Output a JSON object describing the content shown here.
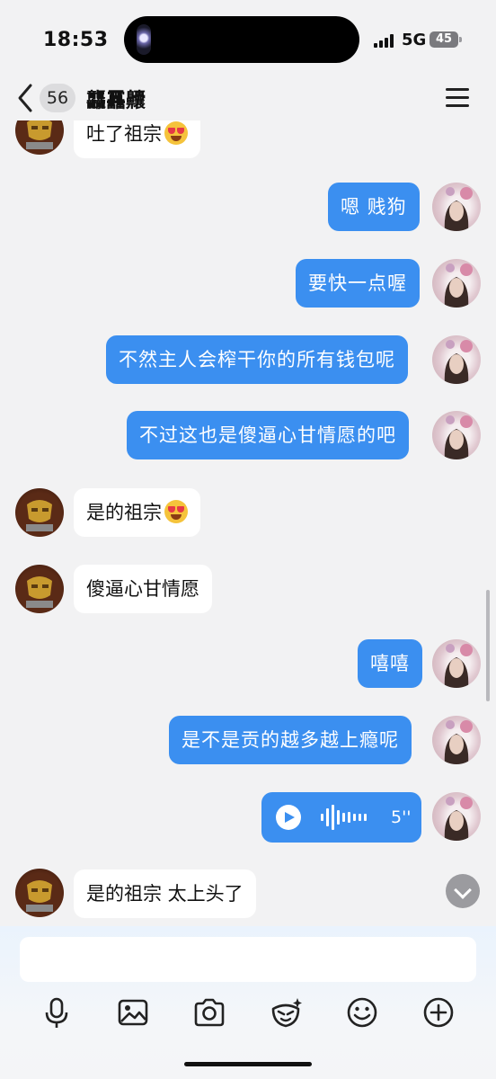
{
  "status": {
    "time": "18:53",
    "network": "5G",
    "battery": "45"
  },
  "header": {
    "unread_count": "56",
    "title": "龘靐齉"
  },
  "messages": [
    {
      "side": "in",
      "text": "吐了祖宗",
      "emoji": "heart-eyes-emoji"
    },
    {
      "side": "out",
      "text": "嗯 贱狗"
    },
    {
      "side": "out",
      "text": "要快一点喔"
    },
    {
      "side": "out",
      "text": "不然主人会榨干你的所有钱包呢"
    },
    {
      "side": "out",
      "text": "不过这也是傻逼心甘情愿的吧"
    },
    {
      "side": "in",
      "text": "是的祖宗",
      "emoji": "heart-eyes-emoji"
    },
    {
      "side": "in",
      "text": "傻逼心甘情愿"
    },
    {
      "side": "out",
      "text": "嘻嘻"
    },
    {
      "side": "out",
      "text": "是不是贡的越多越上瘾呢"
    },
    {
      "side": "out",
      "type": "voice",
      "duration": "5''"
    },
    {
      "side": "in",
      "text": "是的祖宗 太上头了"
    }
  ],
  "input": {
    "value": "",
    "placeholder": ""
  },
  "toolbar": [
    "microphone-icon",
    "image-icon",
    "camera-icon",
    "sticker-icon",
    "emoji-icon",
    "plus-icon"
  ],
  "colors": {
    "outgoing_bubble": "#3b8ff0",
    "incoming_bubble": "#ffffff",
    "background": "#f2f2f3"
  }
}
